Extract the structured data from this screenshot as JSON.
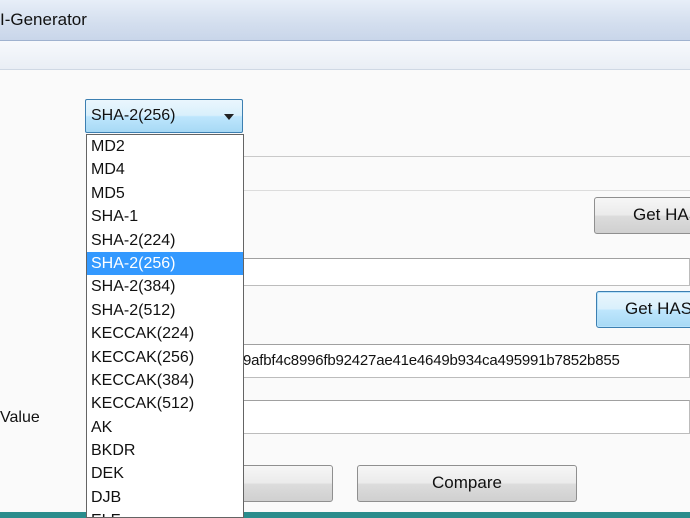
{
  "window": {
    "title": "I-Generator"
  },
  "algorithm_select": {
    "selected": "SHA-2(256)",
    "options": [
      "MD2",
      "MD4",
      "MD5",
      "SHA-1",
      "SHA-2(224)",
      "SHA-2(256)",
      "SHA-2(384)",
      "SHA-2(512)",
      "KECCAK(224)",
      "KECCAK(256)",
      "KECCAK(384)",
      "KECCAK(512)",
      "AK",
      "BKDR",
      "DEK",
      "DJB",
      "ELF"
    ]
  },
  "buttons": {
    "get_hash_1": "Get HASH",
    "get_hash_2": "Get HASH",
    "compare": "Compare"
  },
  "output": {
    "hash_value": "9afbf4c8996fb92427ae41e4649b934ca495991b7852b855"
  },
  "labels": {
    "value": "Value"
  }
}
